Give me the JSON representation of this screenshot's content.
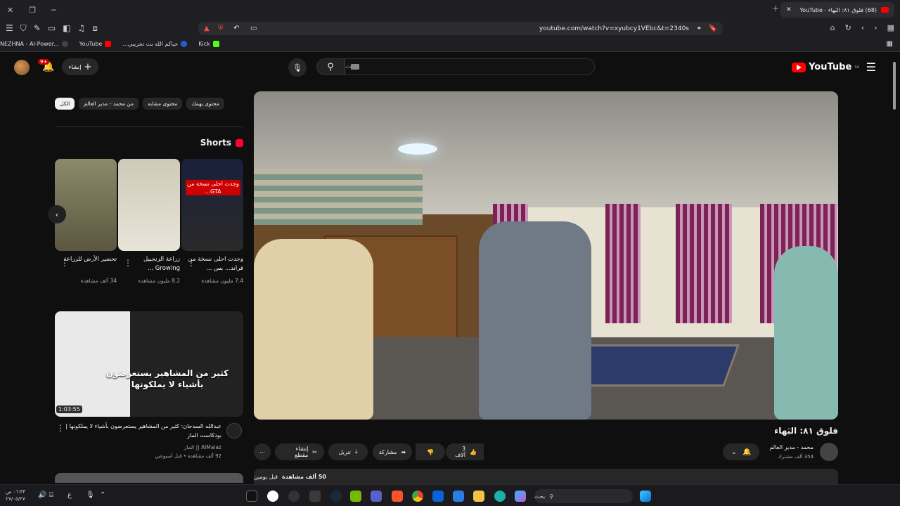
{
  "browser": {
    "tab_title": "(68) فلوق ٨١: البَهاء - YouTube",
    "url": "youtube.com/watch?v=xyubcy1VEbc&t=2340s",
    "bookmarks": [
      {
        "label": "NEZHNA - AI-Power...",
        "color": "#444444"
      },
      {
        "label": "YouTube",
        "color": "#ff0000"
      },
      {
        "label": "حياكم الله بث تجريبي...",
        "color": "#2a5bd7"
      },
      {
        "label": "Kick",
        "color": "#53fc18"
      }
    ]
  },
  "header": {
    "logo_text": "YouTube",
    "logo_country": "SA",
    "search_placeholder": "بحث",
    "create_label": "إنشاء",
    "notif_badge": "9+"
  },
  "chips": [
    {
      "label": "الكل",
      "active": true
    },
    {
      "label": "من محمد - مدير العالم",
      "active": false
    },
    {
      "label": "محتوى مشابه",
      "active": false
    },
    {
      "label": "محتوى يهمك",
      "active": false
    }
  ],
  "shorts": {
    "heading": "Shorts",
    "items": [
      {
        "title": "وجدت احلى نسخة من قراند... بس ...",
        "views": "7.4 مليون مشاهدة",
        "overlay": "وجدت احلى نسخة من GTA..."
      },
      {
        "title": "زراعة الزنجبيل Growing ...",
        "views": "8.2 مليون مشاهدة"
      },
      {
        "title": "تحضير الأرض للزراعة",
        "views": "34 ألف مشاهدة"
      }
    ]
  },
  "recommended": {
    "duration": "1:03:55",
    "title": "عبدالله السدحان: كثير من المشاهير يستعرضون بأشياء لا يملكونها | بودكاست الماز",
    "channel": "AlMaiaz || الماز",
    "meta": "92 ألف مشاهدة • قبل أسبوعين",
    "thumb_text": "كثير من المشاهير يستعرضون بأشياء لا يملكونها"
  },
  "video": {
    "title": "فلوق ٨١: البَهاء",
    "channel": "محمد - مدير العالم",
    "subscribers": "354 ألف مشترك",
    "likes": "3 آلاف",
    "share_label": "مشاركة",
    "download_label": "تنزيل",
    "clip_label": "إنشاء مقطع",
    "views_short": "50 ألف مشاهدة",
    "date": "قبل يومين"
  },
  "taskbar": {
    "search_placeholder": "بحث",
    "time": "٠٦:٣٣ ص",
    "date": "٢٧/٠٥/٢٧",
    "lang": "ع"
  }
}
